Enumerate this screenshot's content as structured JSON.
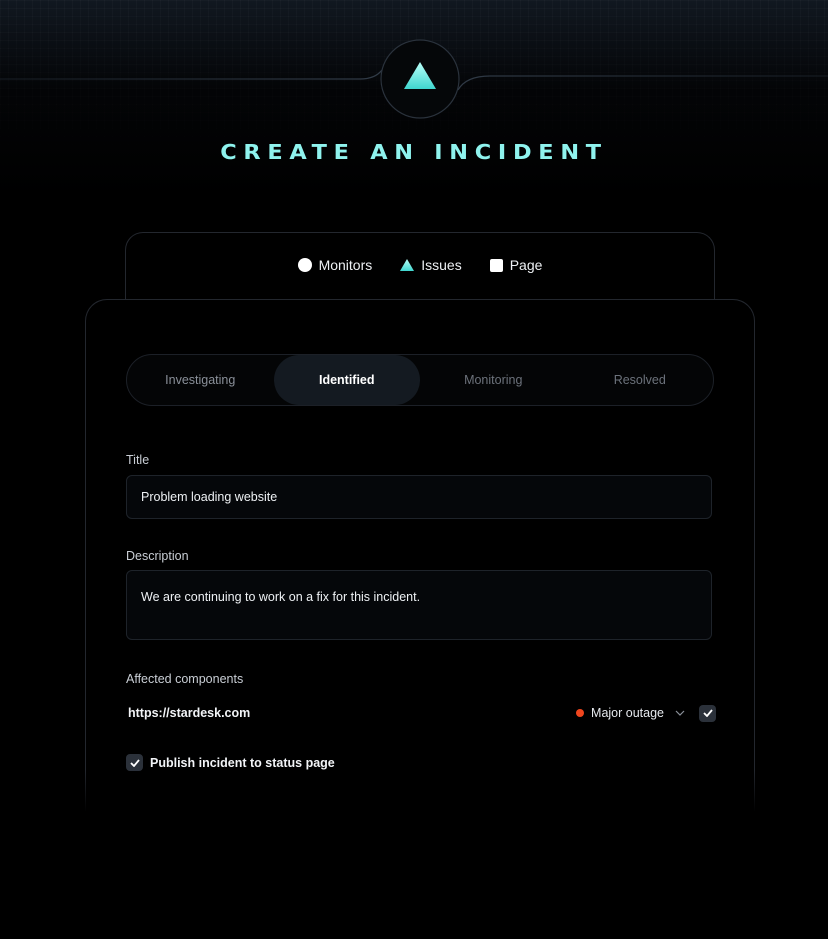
{
  "header": {
    "title": "CREATE AN INCIDENT",
    "logo_icon": "triangle-logo-icon",
    "accent_color": "#8ff3ee"
  },
  "type_tabs": [
    {
      "label": "Monitors",
      "icon": "circle-icon"
    },
    {
      "label": "Issues",
      "icon": "triangle-icon",
      "selected": true
    },
    {
      "label": "Page",
      "icon": "square-icon"
    }
  ],
  "status_options": [
    {
      "label": "Investigating"
    },
    {
      "label": "Identified",
      "selected": true
    },
    {
      "label": "Monitoring"
    },
    {
      "label": "Resolved"
    }
  ],
  "form": {
    "title_label": "Title",
    "title_value": "Problem loading website",
    "description_label": "Description",
    "description_value": "We are continuing to work on a fix for this incident.",
    "components_label": "Affected components",
    "component": {
      "url": "https://stardesk.com",
      "status": "Major outage",
      "status_color": "#f0461e",
      "checked": true
    },
    "publish_label": "Publish incident to status page",
    "publish_checked": true
  }
}
